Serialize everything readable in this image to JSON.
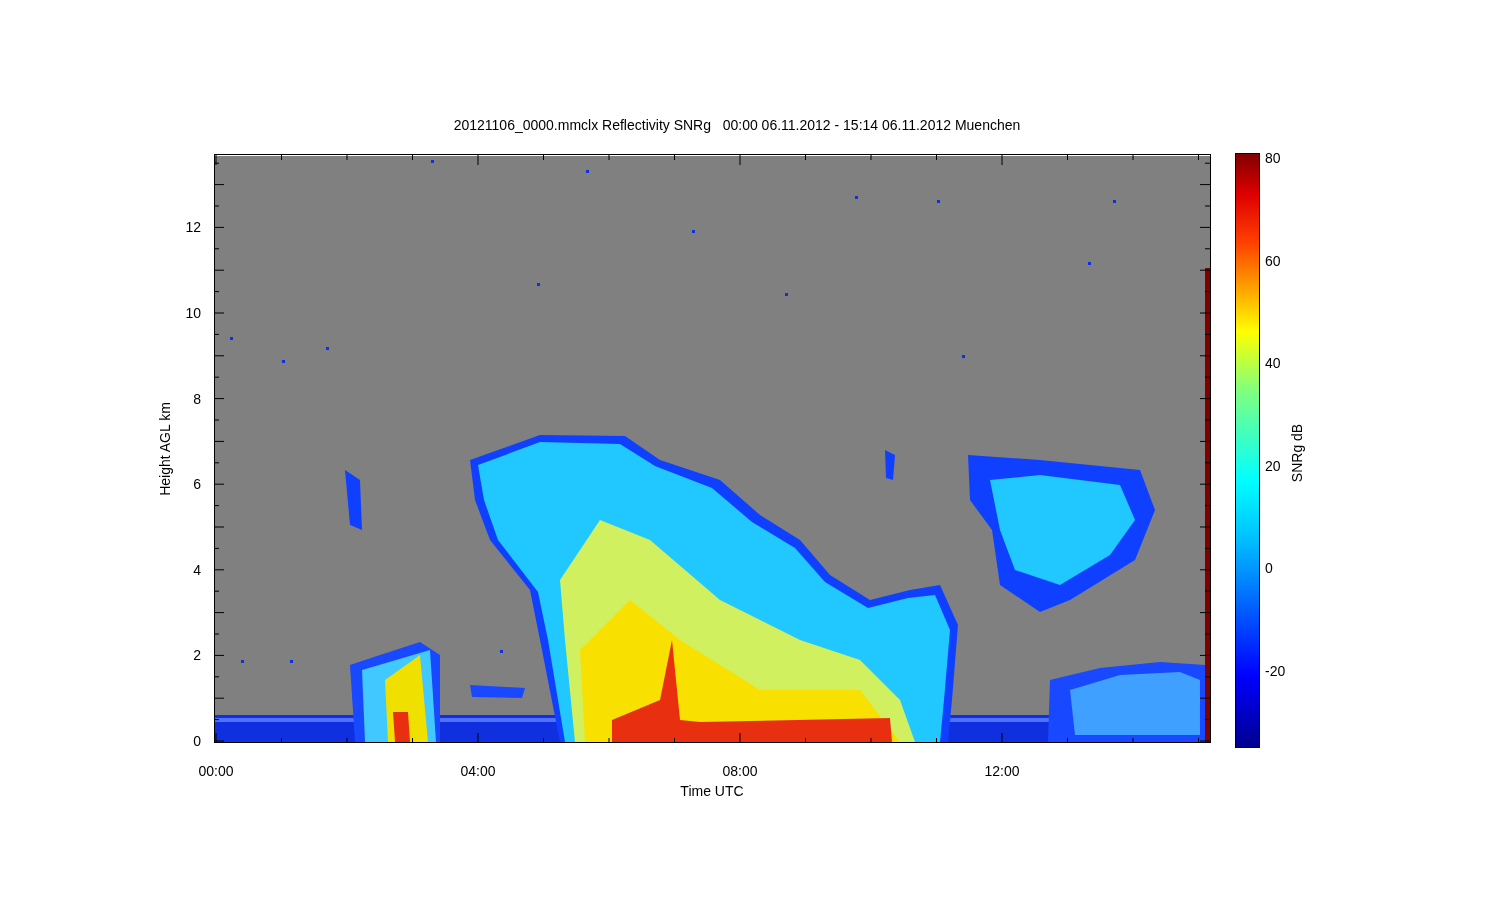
{
  "title": "20121106_0000.mmclx Reflectivity SNRg   00:00 06.11.2012 - 15:14 06.11.2012 Muenchen",
  "y_axis": {
    "label": "Height AGL km",
    "ticks": [
      "12",
      "10",
      "8",
      "6",
      "4",
      "2",
      "0"
    ]
  },
  "x_axis": {
    "label": "Time UTC",
    "ticks": [
      "00:00",
      "04:00",
      "08:00",
      "12:00"
    ]
  },
  "colorbar": {
    "label": "SNRg dB",
    "ticks": [
      "80",
      "60",
      "40",
      "20",
      "0",
      "-20"
    ]
  }
}
